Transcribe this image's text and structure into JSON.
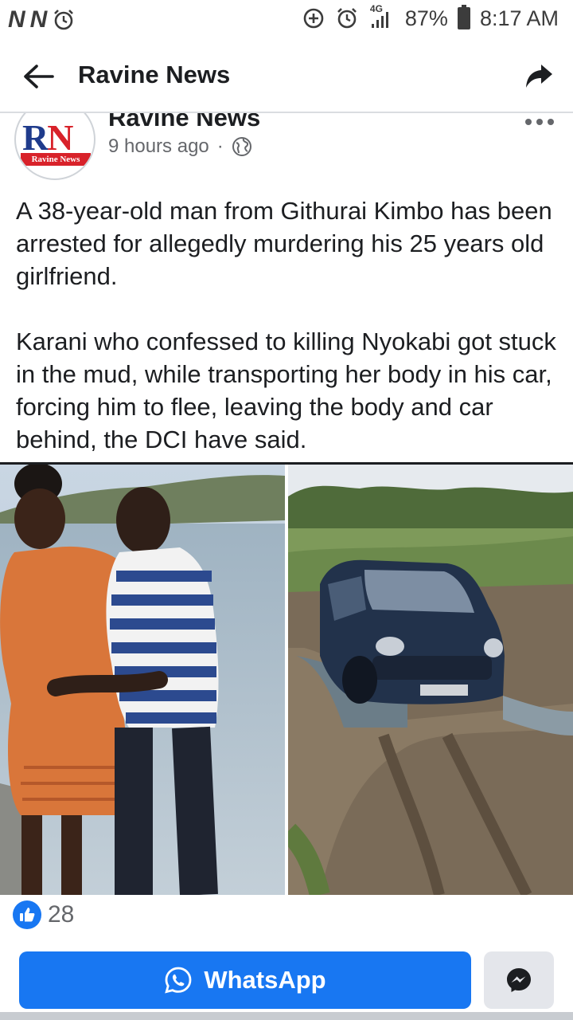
{
  "status_bar": {
    "left_icons": [
      "N",
      "N"
    ],
    "battery": "87%",
    "time": "8:17 AM",
    "network": "4G"
  },
  "header": {
    "title": "Ravine News"
  },
  "post": {
    "page_name": "Ravine News",
    "avatar_letters": [
      "R",
      "N"
    ],
    "avatar_strip": "Ravine News",
    "time_ago": "9 hours ago",
    "separator": "·",
    "paragraphs": [
      "A 38-year-old man from Githurai Kimbo has been arrested for allegedly murdering his 25 years old girlfriend.",
      "Karani who confessed to killing Nyokabi got stuck in the mud, while transporting her body in his car, forcing him to flee, leaving the body and car behind, the DCI have said."
    ],
    "like_count": "28"
  },
  "actions": {
    "whatsapp_label": "WhatsApp"
  },
  "colors": {
    "accent": "#1877f2",
    "secondary_button": "#e4e6eb",
    "muted_text": "#65676b",
    "logo_red": "#d8222a",
    "logo_blue": "#1f3b8c"
  },
  "icons": [
    "back-arrow-icon",
    "share-arrow-icon",
    "more-options-icon",
    "globe-icon",
    "like-icon",
    "whatsapp-icon",
    "messenger-icon",
    "alarm-icon",
    "data-saver-icon",
    "signal-icon",
    "battery-icon"
  ]
}
